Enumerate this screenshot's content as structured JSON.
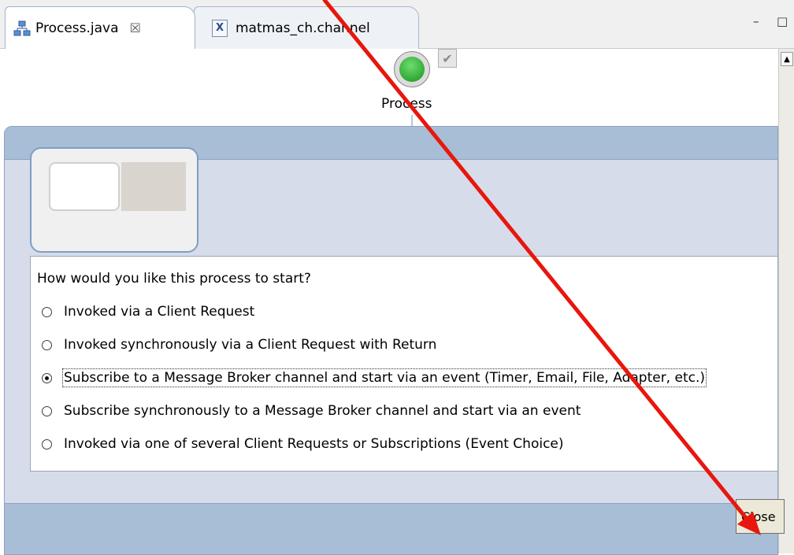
{
  "tabs": [
    {
      "label": "Process.java",
      "close_glyph": "☒",
      "icon": "process-diagram-icon"
    },
    {
      "label": "matmas_ch.channel",
      "icon_text": "X",
      "icon": "xml-file-icon"
    }
  ],
  "window_controls": {
    "minimize": "–",
    "maximize": "□"
  },
  "diagram": {
    "node_label": "Process",
    "check_glyph": "✔"
  },
  "dialog": {
    "question": "How would you like this process to start?",
    "options": [
      {
        "label": "Invoked via a Client Request",
        "selected": false
      },
      {
        "label": "Invoked synchronously via a Client Request with Return",
        "selected": false
      },
      {
        "label": "Subscribe to a Message Broker channel and start via an event (Timer, Email, File, Adapter, etc.)",
        "selected": true
      },
      {
        "label": "Subscribe synchronously to a Message Broker channel and start via an event",
        "selected": false
      },
      {
        "label": "Invoked via one of several Client Requests or Subscriptions (Event Choice)",
        "selected": false
      }
    ],
    "close_label": "Close"
  },
  "colors": {
    "annotation_arrow": "#e8160c",
    "panel_header": "#a8bdd6",
    "panel_body": "#d6dcea",
    "start_node": "#16941c"
  }
}
